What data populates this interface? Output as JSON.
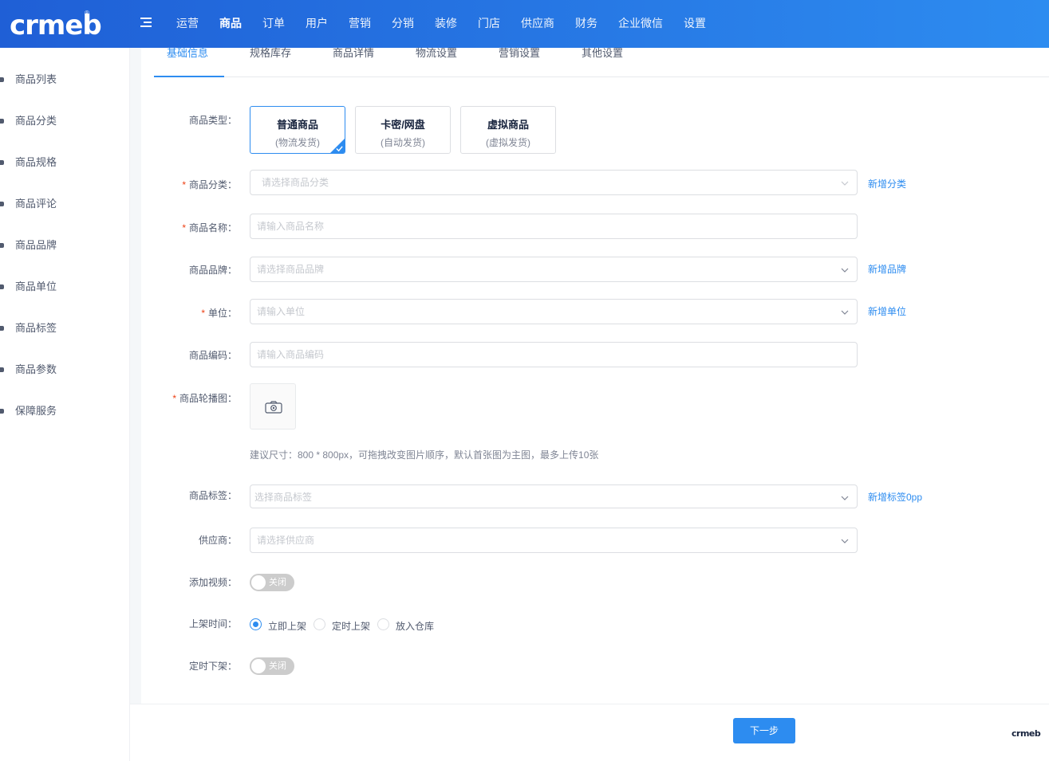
{
  "brand": {
    "logo_text": "crmeb",
    "reg_mark": "®",
    "accent": "#2d8cf0"
  },
  "header": {
    "nav": [
      {
        "label": "运营"
      },
      {
        "label": "商品"
      },
      {
        "label": "订单"
      },
      {
        "label": "用户"
      },
      {
        "label": "营销"
      },
      {
        "label": "分销"
      },
      {
        "label": "装修"
      },
      {
        "label": "门店"
      },
      {
        "label": "供应商"
      },
      {
        "label": "财务"
      },
      {
        "label": "企业微信"
      },
      {
        "label": "设置"
      }
    ],
    "active_nav": "商品"
  },
  "sidebar": {
    "items": [
      {
        "label": "商品列表"
      },
      {
        "label": "商品分类"
      },
      {
        "label": "商品规格"
      },
      {
        "label": "商品评论"
      },
      {
        "label": "商品品牌"
      },
      {
        "label": "商品单位"
      },
      {
        "label": "商品标签"
      },
      {
        "label": "商品参数"
      },
      {
        "label": "保障服务"
      }
    ]
  },
  "tabs": [
    {
      "label": "基础信息"
    },
    {
      "label": "规格库存"
    },
    {
      "label": "商品详情"
    },
    {
      "label": "物流设置"
    },
    {
      "label": "营销设置"
    },
    {
      "label": "其他设置"
    }
  ],
  "active_tab": "基础信息",
  "form": {
    "type": {
      "label": "商品类型：",
      "options": [
        {
          "title": "普通商品",
          "sub": "(物流发货)",
          "selected": true
        },
        {
          "title": "卡密/网盘",
          "sub": "(自动发货)",
          "selected": false
        },
        {
          "title": "虚拟商品",
          "sub": "(虚拟发货)",
          "selected": false
        }
      ]
    },
    "category": {
      "label": "商品分类：",
      "placeholder": "请选择商品分类",
      "link": "新增分类"
    },
    "name": {
      "label": "商品名称：",
      "placeholder": "请输入商品名称"
    },
    "brand": {
      "label": "商品品牌：",
      "placeholder": "请选择商品品牌",
      "link": "新增品牌"
    },
    "unit": {
      "label": "单位：",
      "placeholder": "请输入单位",
      "link": "新增单位"
    },
    "code": {
      "label": "商品编码：",
      "placeholder": "请输入商品编码"
    },
    "carousel": {
      "label": "商品轮播图：",
      "hint": "建议尺寸：800 * 800px，可拖拽改变图片顺序，默认首张图为主图，最多上传10张"
    },
    "tags": {
      "label": "商品标签：",
      "placeholder": "选择商品标签",
      "link": "新增标签0pp"
    },
    "supplier": {
      "label": "供应商：",
      "placeholder": "请选择供应商"
    },
    "video": {
      "label": "添加视频：",
      "switch_text": "关闭"
    },
    "shelf": {
      "label": "上架时间：",
      "options": [
        {
          "label": "立即上架",
          "checked": true
        },
        {
          "label": "定时上架",
          "checked": false
        },
        {
          "label": "放入仓库",
          "checked": false
        }
      ]
    },
    "offshelf": {
      "label": "定时下架：",
      "switch_text": "关闭"
    }
  },
  "footer": {
    "next_label": "下一步",
    "mini_logo": "crmeb"
  }
}
